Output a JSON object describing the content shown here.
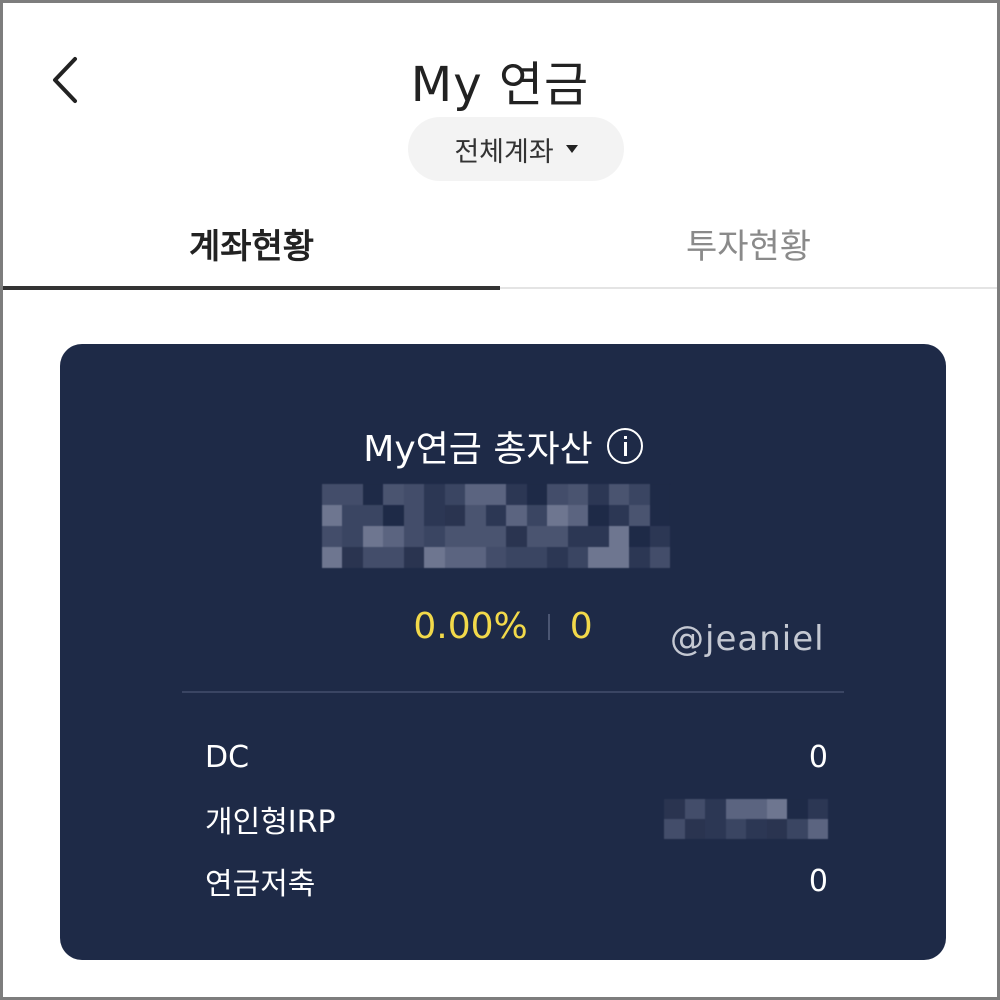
{
  "header": {
    "title": "My 연금",
    "account_select": "전체계좌"
  },
  "tabs": [
    {
      "label": "계좌현황",
      "active": true
    },
    {
      "label": "투자현황",
      "active": false
    }
  ],
  "summary": {
    "title": "My연금 총자산",
    "total_amount": "",
    "return_rate": "0.00%",
    "profit": "0",
    "watermark": "@jeaniel"
  },
  "accounts": [
    {
      "name": "DC",
      "value": "0"
    },
    {
      "name": "개인형IRP",
      "value": ""
    },
    {
      "name": "연금저축",
      "value": "0"
    }
  ],
  "colors": {
    "card_bg": "#1e2a47",
    "accent_yellow": "#f2d94a",
    "tab_active_underline": "#333333"
  }
}
